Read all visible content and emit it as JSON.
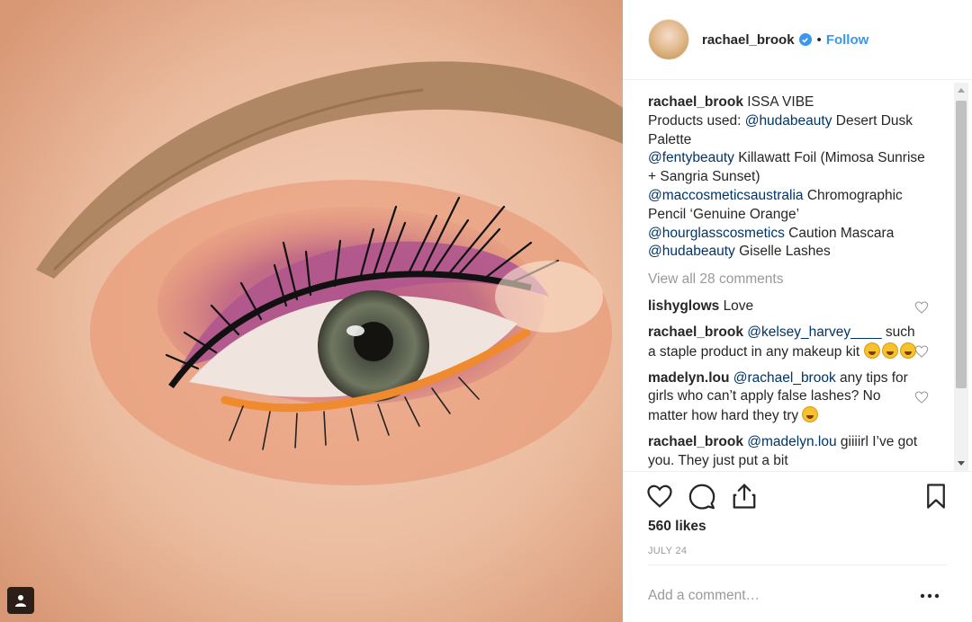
{
  "post": {
    "author": "rachael_brook",
    "follow_label": "Follow",
    "separator": "•"
  },
  "caption": {
    "author": "rachael_brook",
    "title": "ISSA VIBE",
    "line1_prefix": "Products used: ",
    "line1_mention": "@hudabeauty",
    "line1_text": " Desert Dusk Palette",
    "line2_mention": "@fentybeauty",
    "line2_text": " Killawatt Foil (Mimosa Sunrise + Sangria Sunset)",
    "line3_mention": "@maccosmeticsaustralia",
    "line3_text": " Chromographic Pencil ‘Genuine Orange’",
    "line4_mention": "@hourglasscosmetics",
    "line4_text": " Caution Mascara",
    "line5_mention": "@hudabeauty",
    "line5_text": " Giselle Lashes"
  },
  "view_all_comments": "View all 28 comments",
  "comments": [
    {
      "user": "lishyglows",
      "text": "Love"
    },
    {
      "user": "rachael_brook",
      "mention": "@kelsey_harvey____",
      "text": "such a staple product in any makeup kit"
    },
    {
      "user": "madelyn.lou",
      "mention": "@rachael_brook",
      "text": "any tips for girls who can’t apply false lashes? No matter how hard they try"
    },
    {
      "user": "rachael_brook",
      "mention": "@madelyn.lou",
      "text": "giiiirl I’ve got you. They just put a bit"
    }
  ],
  "likes": "560 likes",
  "date": "JULY 24",
  "add_comment": {
    "placeholder": "Add a comment…"
  },
  "icons": {
    "like": "heart-icon",
    "comment": "comment-icon",
    "share": "share-icon",
    "save": "bookmark-icon",
    "more": "more-options-icon",
    "tag": "user-tag-icon",
    "verified": "verified-badge-icon"
  },
  "colors": {
    "link": "#3897f0",
    "mention": "#003569",
    "muted": "#999999",
    "text": "#262626"
  }
}
